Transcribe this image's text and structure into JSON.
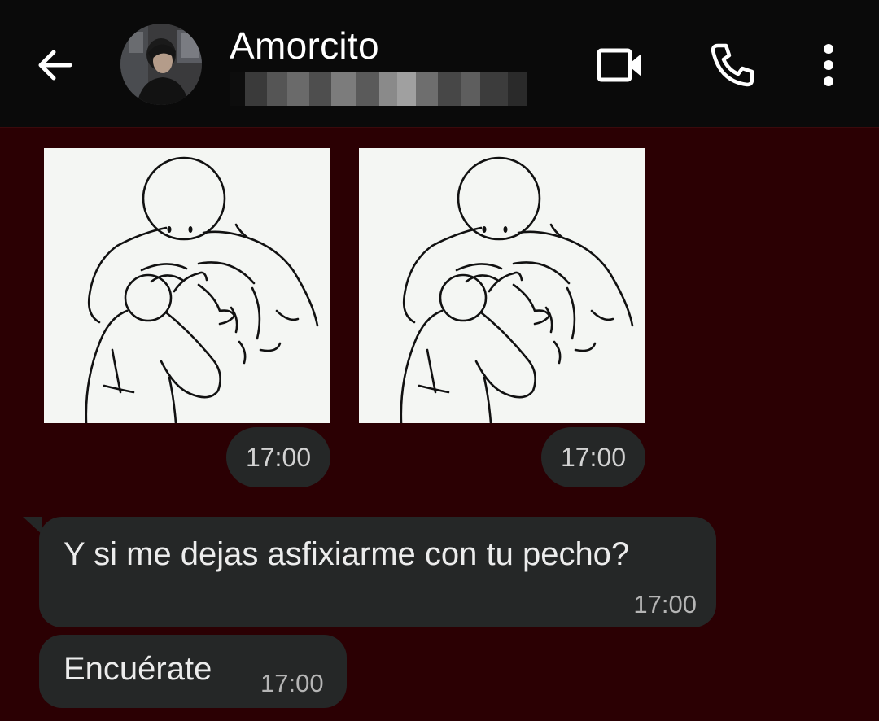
{
  "header": {
    "contact_name": "Amorcito",
    "icons": {
      "back": "arrow-left-icon",
      "video": "video-call-icon",
      "call": "phone-icon",
      "menu": "more-vertical-icon"
    }
  },
  "messages": [
    {
      "type": "image",
      "image": "cartoon-hug-illustration",
      "time": "17:00"
    },
    {
      "type": "image",
      "image": "cartoon-hug-illustration",
      "time": "17:00"
    },
    {
      "type": "text",
      "text": "Y si me dejas asfixiarme con tu pecho?",
      "time": "17:00"
    },
    {
      "type": "text",
      "text": "Encuérate",
      "time": "17:00"
    }
  ],
  "colors": {
    "chat_background": "#2b0003",
    "header_background": "#0a0a0a",
    "bubble_background": "#252727",
    "text": "#ececec"
  }
}
